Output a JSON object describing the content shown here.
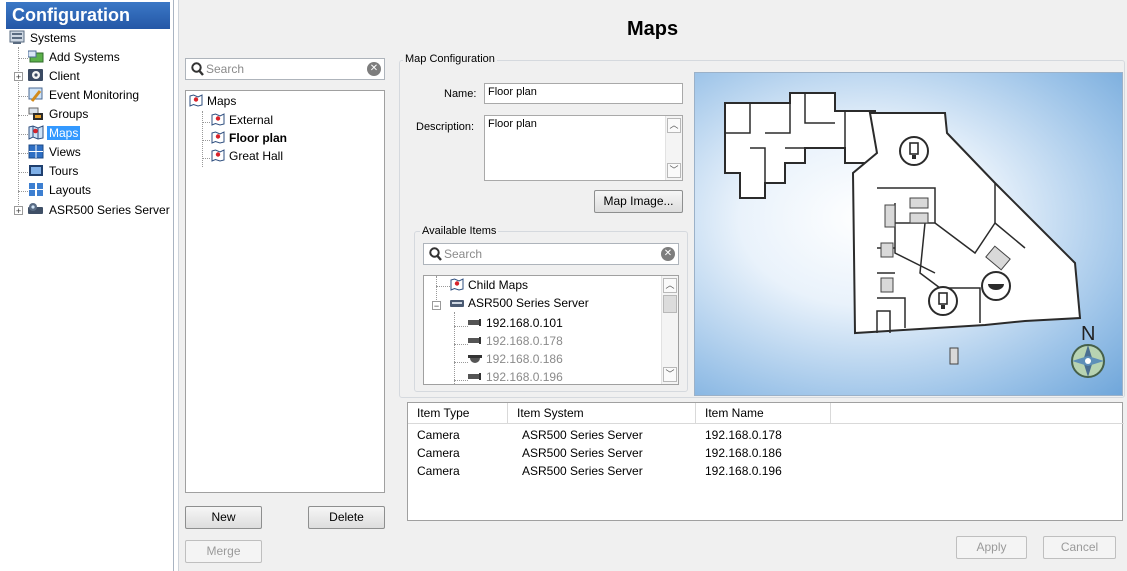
{
  "sidebar": {
    "title": "Configuration",
    "items": [
      {
        "label": "Systems",
        "icon": "systems-icon"
      },
      {
        "label": "Add Systems",
        "icon": "add-systems-icon"
      },
      {
        "label": "Client",
        "icon": "client-gear-icon"
      },
      {
        "label": "Event Monitoring",
        "icon": "event-monitoring-icon"
      },
      {
        "label": "Groups",
        "icon": "groups-icon"
      },
      {
        "label": "Maps",
        "icon": "maps-icon",
        "selected": true
      },
      {
        "label": "Views",
        "icon": "views-icon"
      },
      {
        "label": "Tours",
        "icon": "tours-icon"
      },
      {
        "label": "Layouts",
        "icon": "layouts-icon"
      },
      {
        "label": "ASR500 Series Server",
        "icon": "server-icon"
      }
    ]
  },
  "page": {
    "title": "Maps"
  },
  "maps_panel": {
    "search_placeholder": "Search",
    "tree": {
      "root": "Maps",
      "children": [
        {
          "label": "External",
          "bold": false
        },
        {
          "label": "Floor plan",
          "bold": true
        },
        {
          "label": "Great Hall",
          "bold": false
        }
      ]
    },
    "buttons": {
      "new": "New",
      "delete": "Delete",
      "merge": "Merge"
    }
  },
  "map_config": {
    "group_label": "Map Configuration",
    "name_label": "Name:",
    "name_value": "Floor plan",
    "description_label": "Description:",
    "description_value": "Floor plan",
    "map_image_button": "Map Image...",
    "available_items": {
      "group_label": "Available Items",
      "search_placeholder": "Search",
      "tree": [
        {
          "label": "Child Maps",
          "icon": "maps-icon"
        },
        {
          "label": "ASR500 Series Server",
          "icon": "server-icon"
        },
        {
          "label": "192.168.0.101",
          "icon": "bullet-camera-icon",
          "dimmed": false
        },
        {
          "label": "192.168.0.178",
          "icon": "bullet-camera-icon",
          "dimmed": true
        },
        {
          "label": "192.168.0.186",
          "icon": "dome-camera-icon",
          "dimmed": true
        },
        {
          "label": "192.168.0.196",
          "icon": "bullet-camera-icon",
          "dimmed": true
        }
      ]
    },
    "compass_letter": "N"
  },
  "items_table": {
    "columns": [
      "Item Type",
      "Item System",
      "Item Name"
    ],
    "rows": [
      [
        "Camera",
        "ASR500 Series Server",
        "192.168.0.178"
      ],
      [
        "Camera",
        "ASR500 Series Server",
        "192.168.0.186"
      ],
      [
        "Camera",
        "ASR500 Series Server",
        "192.168.0.196"
      ]
    ]
  },
  "footer": {
    "apply": "Apply",
    "cancel": "Cancel"
  },
  "colors": {
    "accent": "#2457a6",
    "selection": "#3399ff",
    "map_sky": "#6fa6da",
    "floor": "#ffffff"
  }
}
